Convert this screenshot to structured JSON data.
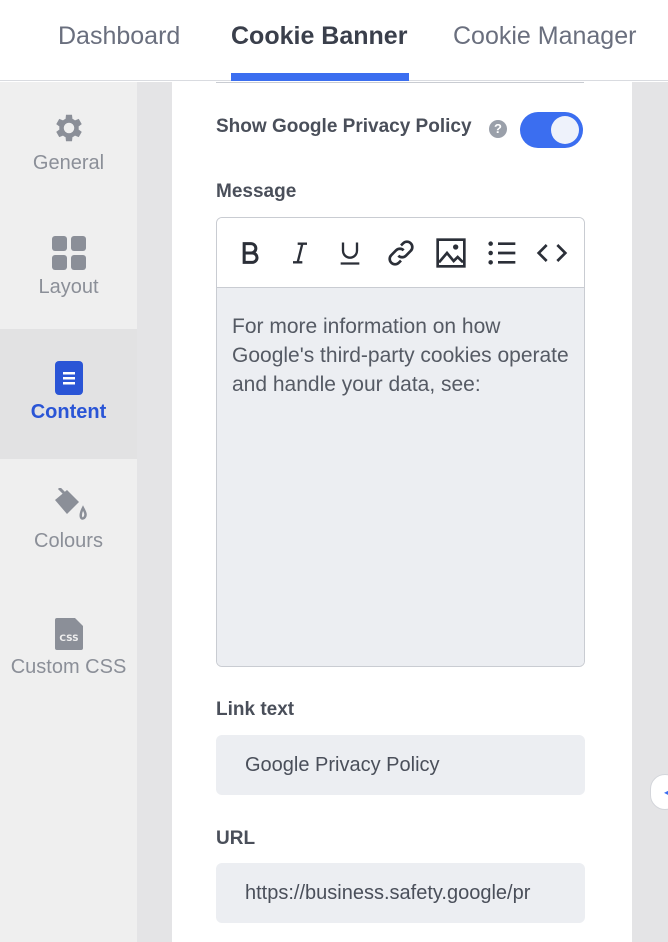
{
  "tabs": {
    "dashboard": "Dashboard",
    "cookie_banner": "Cookie Banner",
    "cookie_manager": "Cookie Manager"
  },
  "sidebar": {
    "items": [
      {
        "label": "General",
        "icon": "gear-icon"
      },
      {
        "label": "Layout",
        "icon": "grid-icon"
      },
      {
        "label": "Content",
        "icon": "document-icon",
        "active": true
      },
      {
        "label": "Colours",
        "icon": "paint-bucket-icon"
      },
      {
        "label": "Custom CSS",
        "icon": "css-file-icon"
      }
    ]
  },
  "form": {
    "show_policy_label": "Show Google Privacy Policy",
    "show_policy_enabled": true,
    "message_label": "Message",
    "message_text": "For more information on how Google's third-party cookies operate and handle your data, see:",
    "link_text_label": "Link text",
    "link_text_value": "Google Privacy Policy",
    "url_label": "URL",
    "url_value": "https://business.safety.google/pr"
  },
  "toolbar_icons": [
    "bold-icon",
    "italic-icon",
    "underline-icon",
    "link-icon",
    "image-icon",
    "list-icon",
    "code-icon"
  ],
  "colors": {
    "accent": "#3b6ef0",
    "active_sidebar_text": "#2a55d6"
  }
}
